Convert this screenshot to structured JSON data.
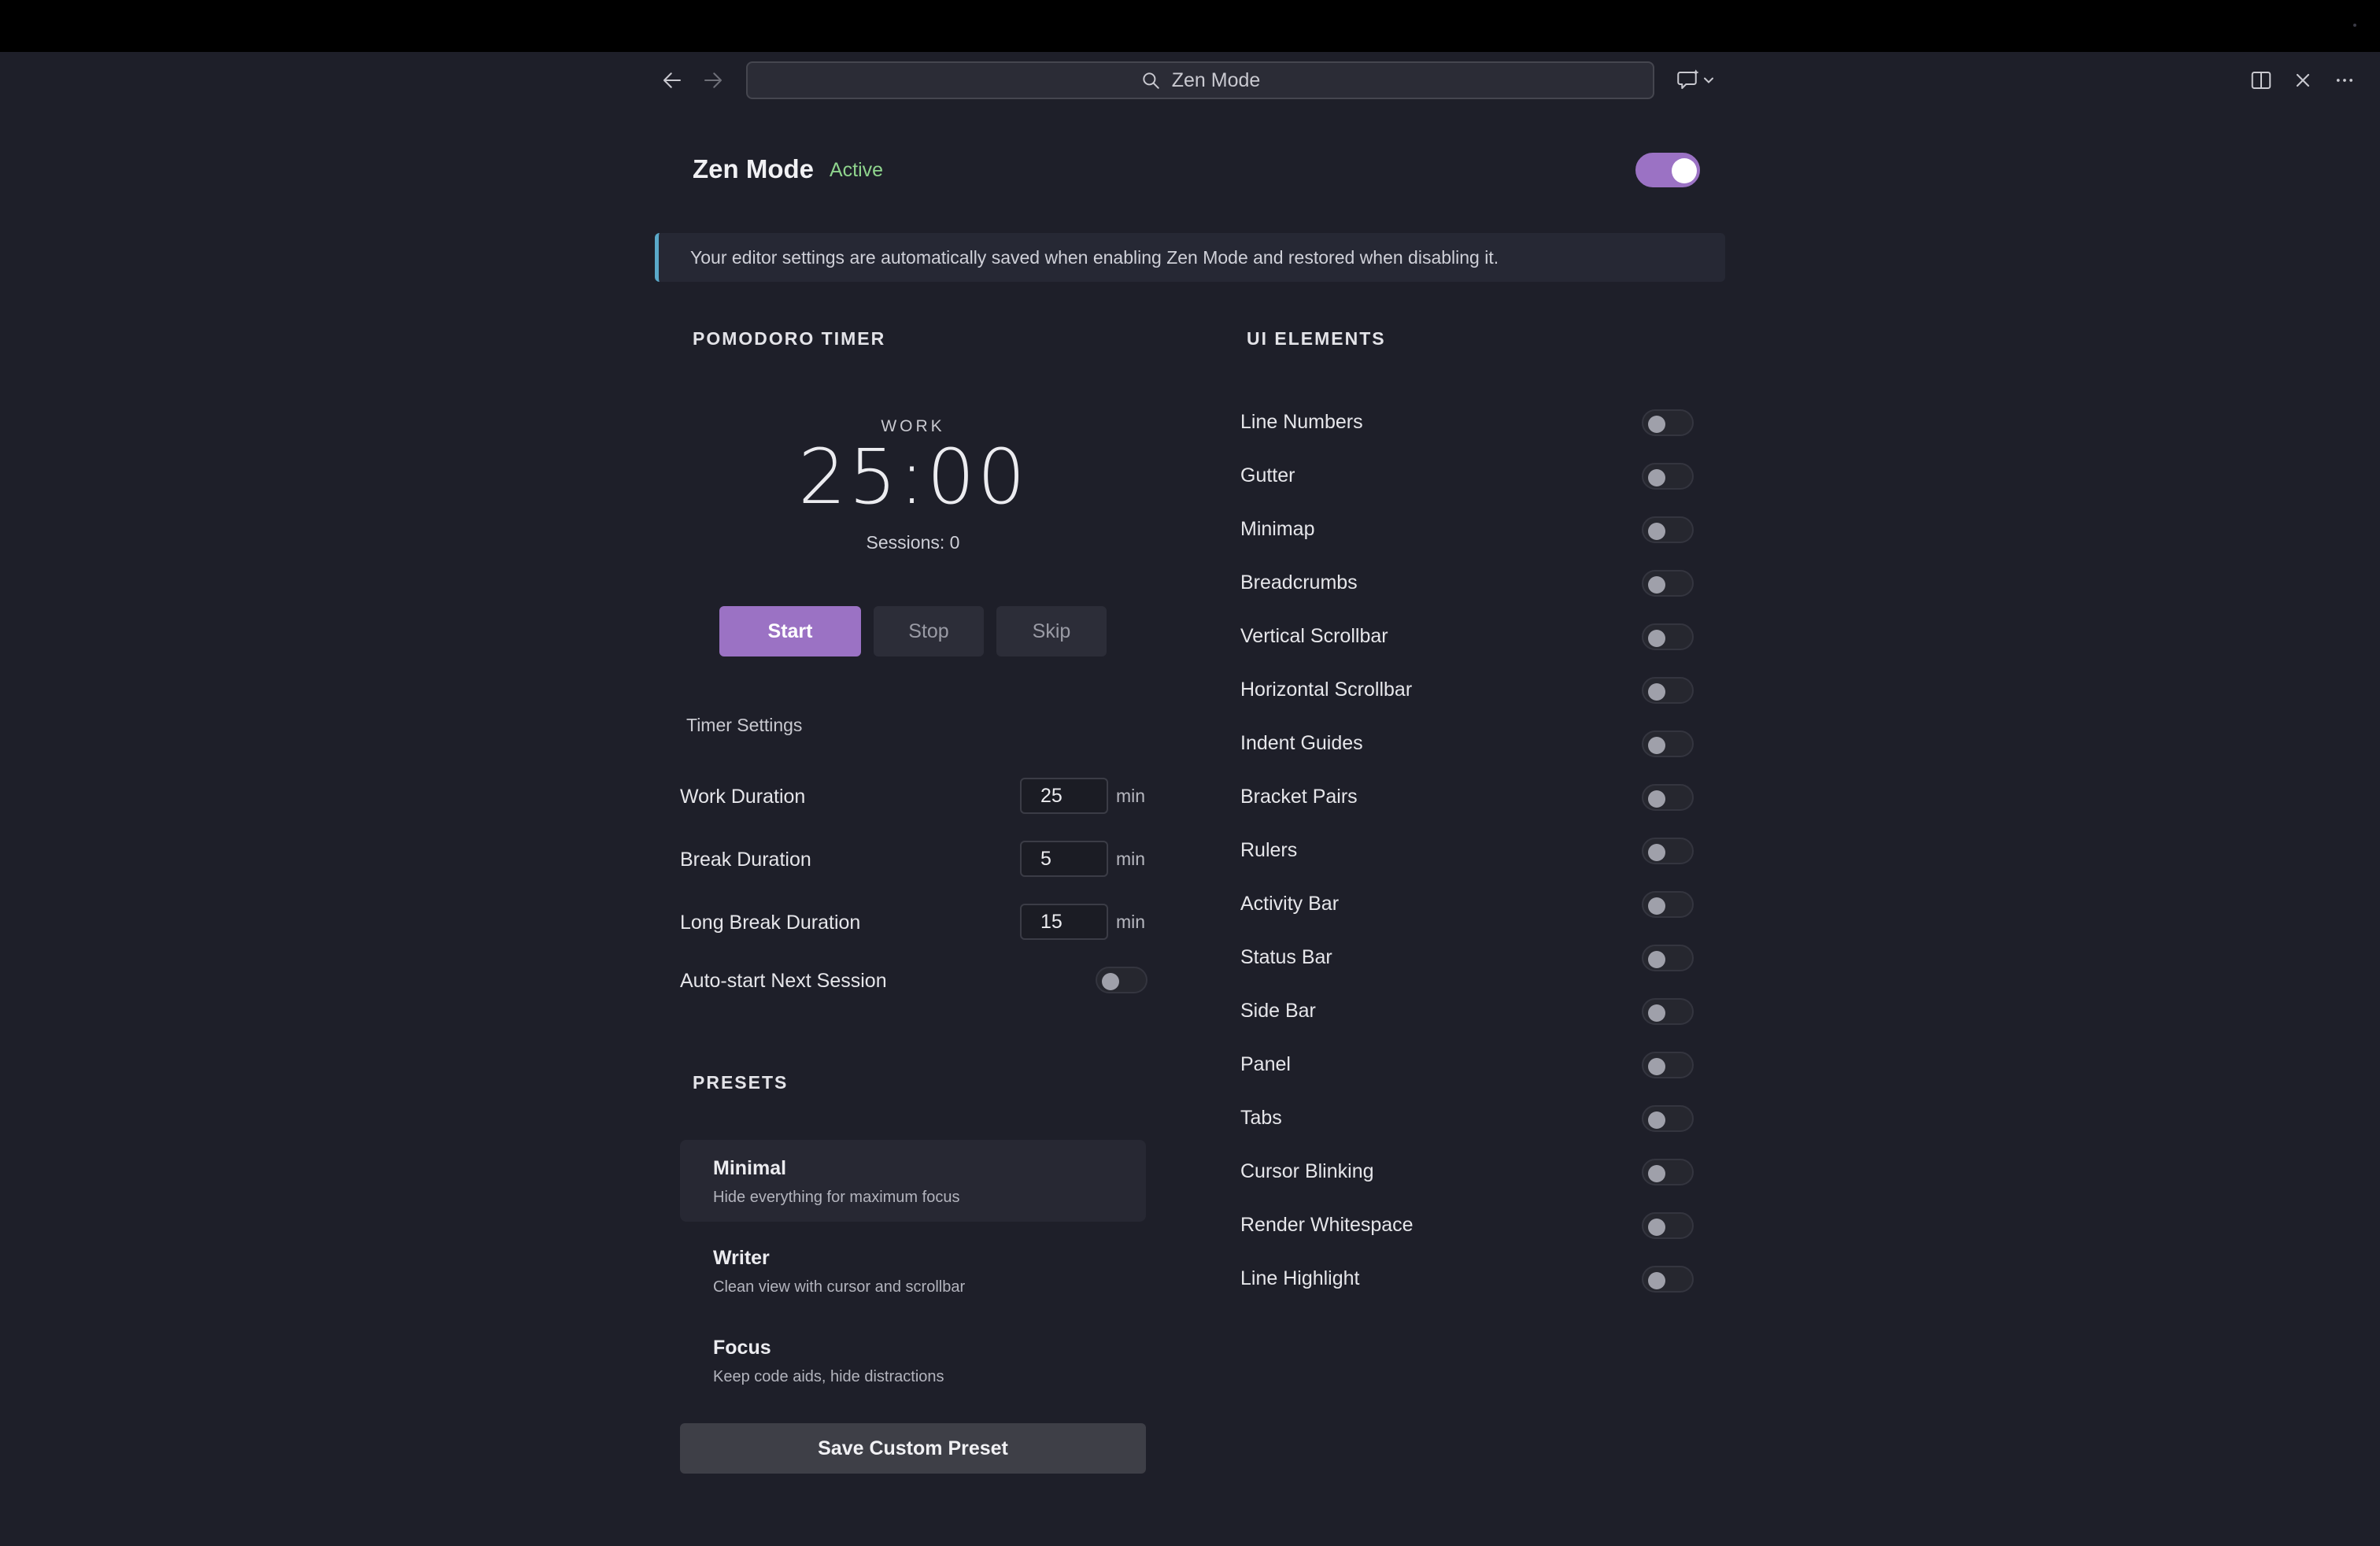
{
  "window": {
    "search_text": "Zen Mode"
  },
  "header": {
    "title": "Zen Mode",
    "status": "Active",
    "enabled": true
  },
  "info": "Your editor settings are automatically saved when enabling Zen Mode and restored when disabling it.",
  "pomodoro": {
    "section_title": "POMODORO TIMER",
    "phase": "WORK",
    "time": "25:00",
    "sessions": "Sessions: 0",
    "buttons": {
      "start": "Start",
      "stop": "Stop",
      "skip": "Skip"
    },
    "settings_title": "Timer Settings",
    "settings": [
      {
        "label": "Work Duration",
        "value": "25",
        "unit": "min"
      },
      {
        "label": "Break Duration",
        "value": "5",
        "unit": "min"
      },
      {
        "label": "Long Break Duration",
        "value": "15",
        "unit": "min"
      }
    ],
    "auto_start": {
      "label": "Auto-start Next Session",
      "enabled": false
    }
  },
  "presets": {
    "section_title": "PRESETS",
    "items": [
      {
        "name": "Minimal",
        "description": "Hide everything for maximum focus",
        "selected": true
      },
      {
        "name": "Writer",
        "description": "Clean view with cursor and scrollbar",
        "selected": false
      },
      {
        "name": "Focus",
        "description": "Keep code aids, hide distractions",
        "selected": false
      }
    ],
    "save_label": "Save Custom Preset"
  },
  "ui_elements": {
    "section_title": "UI ELEMENTS",
    "items": [
      {
        "label": "Line Numbers",
        "enabled": false
      },
      {
        "label": "Gutter",
        "enabled": false
      },
      {
        "label": "Minimap",
        "enabled": false
      },
      {
        "label": "Breadcrumbs",
        "enabled": false
      },
      {
        "label": "Vertical Scrollbar",
        "enabled": false
      },
      {
        "label": "Horizontal Scrollbar",
        "enabled": false
      },
      {
        "label": "Indent Guides",
        "enabled": false
      },
      {
        "label": "Bracket Pairs",
        "enabled": false
      },
      {
        "label": "Rulers",
        "enabled": false
      },
      {
        "label": "Activity Bar",
        "enabled": false
      },
      {
        "label": "Status Bar",
        "enabled": false
      },
      {
        "label": "Side Bar",
        "enabled": false
      },
      {
        "label": "Panel",
        "enabled": false
      },
      {
        "label": "Tabs",
        "enabled": false
      },
      {
        "label": "Cursor Blinking",
        "enabled": false
      },
      {
        "label": "Render Whitespace",
        "enabled": false
      },
      {
        "label": "Line Highlight",
        "enabled": false
      }
    ]
  },
  "colors": {
    "accent": "#9b72c4",
    "active_status": "#8fd48d",
    "info_border": "#5aa9c9",
    "background": "#1e1f29"
  },
  "icons": {
    "back": "arrow-left-icon",
    "forward": "arrow-right-icon",
    "search": "search-icon",
    "chat": "chat-sparkle-icon",
    "split": "split-editor-icon",
    "close": "close-icon",
    "more": "more-icon"
  }
}
